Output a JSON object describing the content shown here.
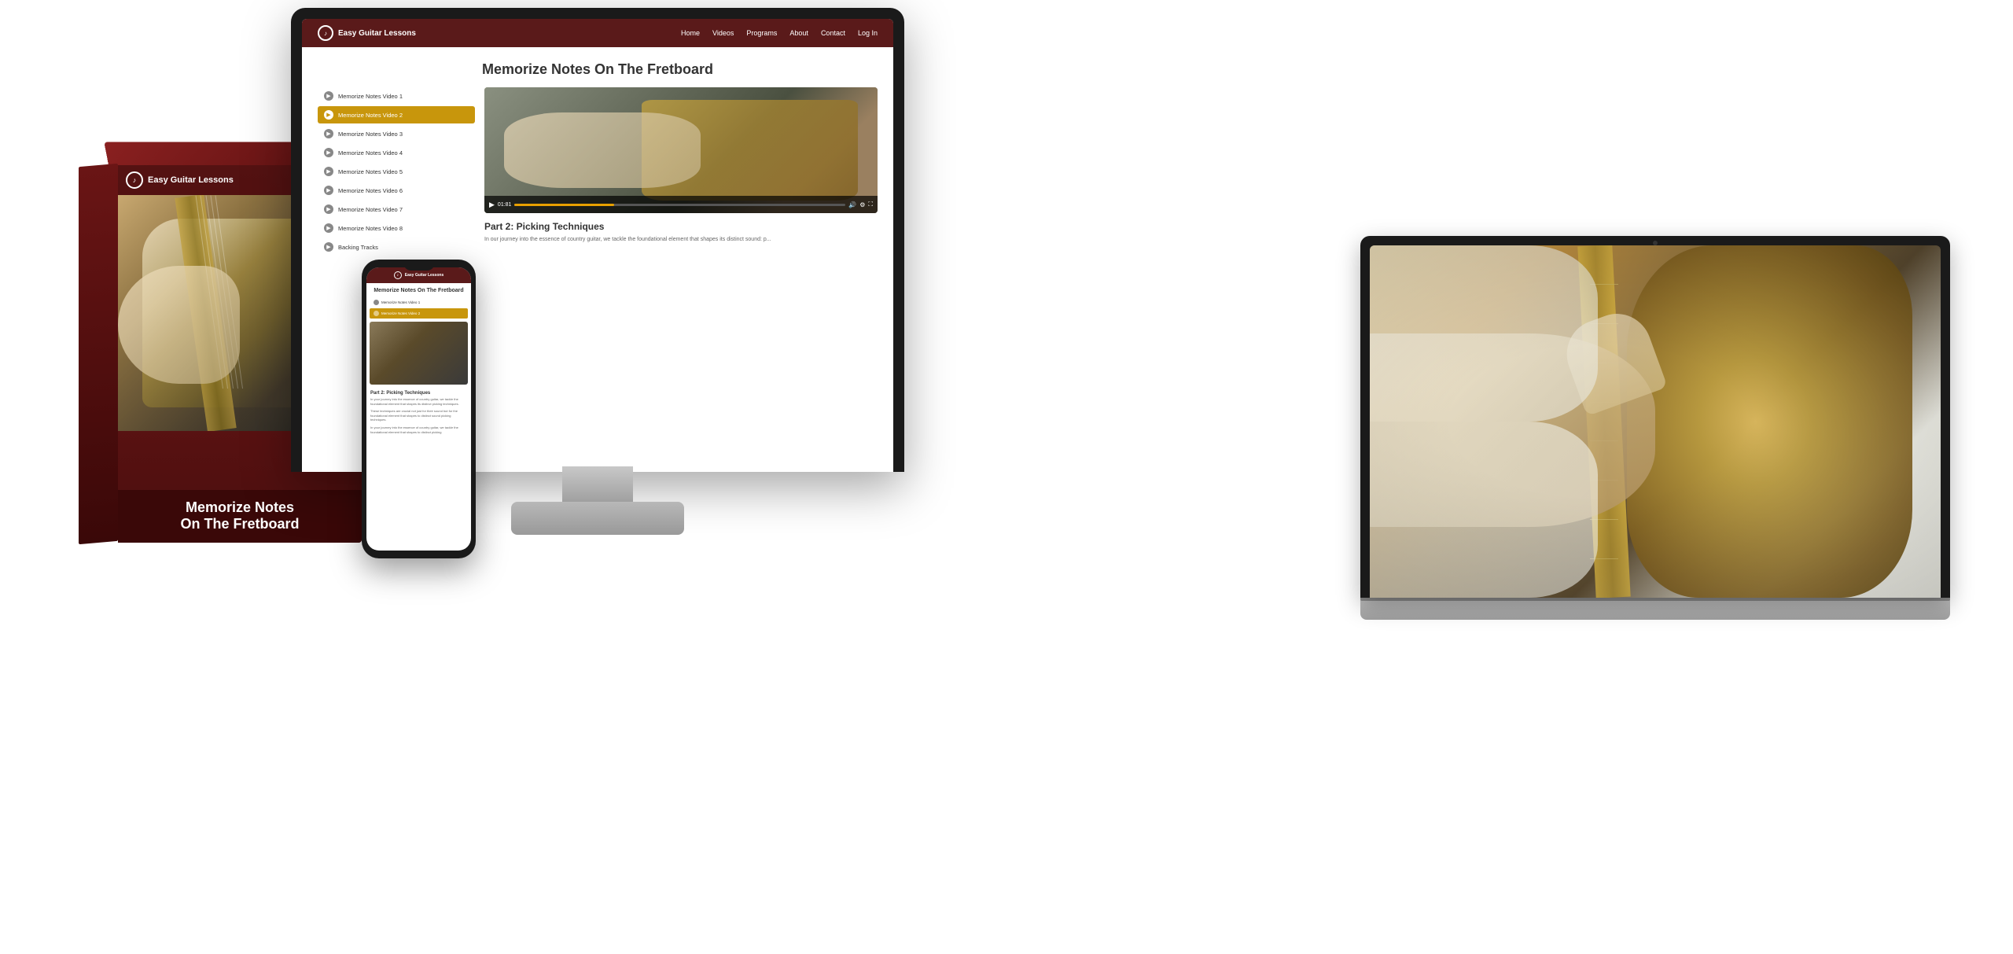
{
  "brand": {
    "name": "Easy Guitar Lessons",
    "logo_symbol": "♪"
  },
  "nav": {
    "links": [
      "Home",
      "Videos",
      "Programs",
      "About",
      "Contact",
      "Log In"
    ]
  },
  "page": {
    "title": "Memorize Notes On The Fretboard"
  },
  "sidebar": {
    "items": [
      {
        "label": "Memorize Notes Video 1",
        "active": false
      },
      {
        "label": "Memorize Notes Video 2",
        "active": true
      },
      {
        "label": "Memorize Notes Video 3",
        "active": false
      },
      {
        "label": "Memorize Notes Video 4",
        "active": false
      },
      {
        "label": "Memorize Notes Video 5",
        "active": false
      },
      {
        "label": "Memorize Notes Video 6",
        "active": false
      },
      {
        "label": "Memorize Notes Video 7",
        "active": false
      },
      {
        "label": "Memorize Notes Video 8",
        "active": false
      },
      {
        "label": "Backing Tracks",
        "active": false
      }
    ]
  },
  "video": {
    "time": "01:81",
    "section_title": "Part 2: Picking Techniques",
    "section_text": "In our journey into the essence of country guitar, we tackle the foundational element that shapes its distinct sound: p..."
  },
  "box": {
    "brand": "Easy Guitar Lessons",
    "footer_line1": "Memorize Notes",
    "footer_line2": "On The Fretboard"
  },
  "phone": {
    "page_title": "Memorize Notes On The\nFretboard",
    "section_title": "Part 2: Picking Techniques",
    "section_text": "In your journey into the essence of country guitar, we tackle the foundational element that shapes its distinct picking techniques.",
    "section_text2": "These techniques are crucial not just for their sound but for the foundational element that shapes to distinct sound picking techniques.",
    "section_text3": "In your journey into the essence of country guitar, we tackle the foundational element that shapes to distinct picking"
  },
  "colors": {
    "nav_dark": "#5a1a1a",
    "accent_gold": "#c8960c",
    "box_dark": "#4a0e0e",
    "text_dark": "#333333",
    "text_muted": "#666666"
  }
}
